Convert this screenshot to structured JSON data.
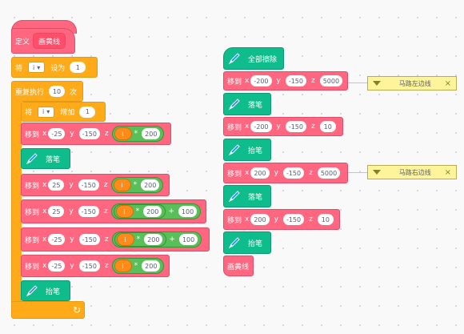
{
  "define_block": {
    "define_label": "定义",
    "proc_name": "画黄线",
    "set_var": {
      "prefix": "将",
      "var": "i",
      "middle": "设为",
      "value": "1"
    },
    "repeat": {
      "prefix": "重复执行",
      "times": "10",
      "suffix": "次"
    },
    "change_var": {
      "prefix": "将",
      "var": "i",
      "middle": "增加",
      "value": "1"
    },
    "goto_label": "移到",
    "x_label": "x",
    "y_label": "y",
    "z_label": "z",
    "moves": [
      {
        "x": "-25",
        "y": "-150",
        "z_var": "i",
        "op": "*",
        "operand": "200"
      },
      {
        "x": "25",
        "y": "-150",
        "z_var": "i",
        "op": "*",
        "operand": "200"
      },
      {
        "x": "25",
        "y": "-150",
        "z_var": "i",
        "op": "*",
        "operand": "200",
        "op2": "+",
        "operand2": "100"
      },
      {
        "x": "-25",
        "y": "-150",
        "z_var": "i",
        "op": "*",
        "operand": "200",
        "op2": "+",
        "operand2": "100"
      },
      {
        "x": "-25",
        "y": "-150",
        "z_var": "i",
        "op": "*",
        "operand": "200"
      }
    ],
    "pen_down_label": "落笔",
    "pen_up_label": "抬笔",
    "loop_arrow": "↻"
  },
  "main_script": {
    "clear_label": "全部擦除",
    "goto_label": "移到",
    "x_label": "x",
    "y_label": "y",
    "z_label": "z",
    "steps": [
      {
        "x": "-200",
        "y": "-150",
        "z": "5000"
      },
      {
        "x": "-200",
        "y": "-150",
        "z": "10"
      },
      {
        "x": "200",
        "y": "-150",
        "z": "5000"
      },
      {
        "x": "200",
        "y": "-150",
        "z": "10"
      }
    ],
    "pen_down_label": "落笔",
    "pen_up_label": "抬笔",
    "call_label": "画黄线"
  },
  "comments": [
    {
      "text": "马路左边线",
      "close": "×"
    },
    {
      "text": "马路右边线",
      "close": "×"
    }
  ],
  "colors": {
    "motion": "#ff6680",
    "control": "#ffab19",
    "pen": "#0fbd8c",
    "variable": "#ff8c1a",
    "operator": "#59c059",
    "comment": "#fef49c"
  },
  "icons": {
    "pen": "pen-icon"
  }
}
